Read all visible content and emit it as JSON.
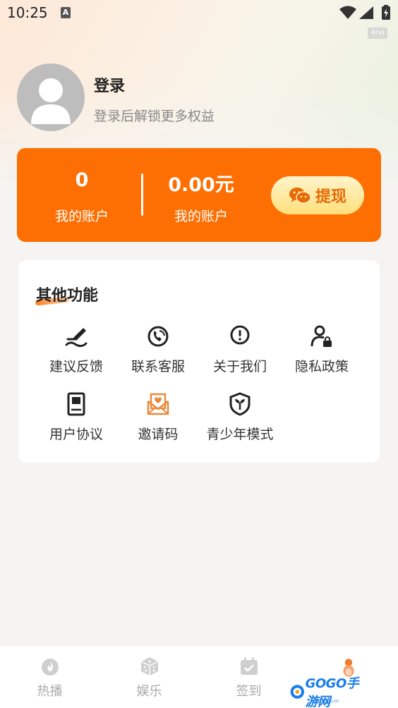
{
  "status_bar": {
    "time": "10:25",
    "tag": "4rvi"
  },
  "profile": {
    "title": "登录",
    "subtitle": "登录后解锁更多权益"
  },
  "wallet": {
    "stats": [
      {
        "value": "0",
        "label": "我的账户"
      },
      {
        "value": "0.00元",
        "label": "我的账户"
      }
    ],
    "withdraw_label": "提现",
    "accent_color": "#fd6f02"
  },
  "features": {
    "title": "其他功能",
    "items": [
      {
        "label": "建议反馈",
        "icon": "feedback-pen-icon"
      },
      {
        "label": "联系客服",
        "icon": "phone-service-icon"
      },
      {
        "label": "关于我们",
        "icon": "info-exclamation-icon"
      },
      {
        "label": "隐私政策",
        "icon": "user-lock-icon"
      },
      {
        "label": "用户协议",
        "icon": "agreement-book-icon"
      },
      {
        "label": "邀请码",
        "icon": "invite-envelope-icon"
      },
      {
        "label": "青少年模式",
        "icon": "teen-shield-icon"
      }
    ]
  },
  "bottom_nav": {
    "items": [
      {
        "label": "热播",
        "icon": "play-flame-icon"
      },
      {
        "label": "娱乐",
        "icon": "dice-icon"
      },
      {
        "label": "签到",
        "icon": "calendar-check-icon"
      },
      {
        "label": "",
        "icon": "profile-mascot-icon"
      }
    ]
  },
  "watermark": {
    "text": "GOGO手游网",
    "sub": "www.gogo.cn"
  }
}
